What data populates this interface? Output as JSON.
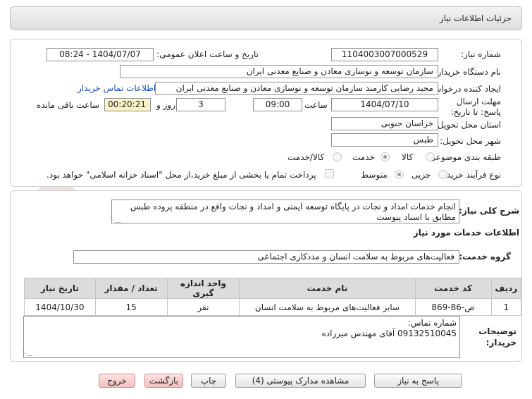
{
  "header": {
    "title": "جزئیات اطلاعات نیاز"
  },
  "form": {
    "need_number_label": "شماره نیاز:",
    "need_number": "1104003007000529",
    "announce_label": "تاریخ و ساعت اعلان عمومی:",
    "announce_value": "1404/07/07 - 08:24",
    "buyer_org_label": "نام دستگاه خریدار:",
    "buyer_org": "سازمان توسعه و نوسازی معادن و صنایع معدنی ایران",
    "creator_label": "ایجاد کننده درخواست:",
    "creator": "مجید رضایی  کارمند  سازمان توسعه و نوسازی معادن و صنایع معدنی ایران",
    "contact_link": "اطلاعات تماس خریدار",
    "deadline_label": "مهلت ارسال پاسخ: تا تاریخ:",
    "deadline_date": "1404/07/10",
    "time_label": "ساعت",
    "deadline_time": "09:00",
    "days_value": "3",
    "days_label": "روز و",
    "remaining_value": "00:20:21",
    "remaining_label": "ساعت باقی مانده",
    "province_label": "استان محل تحویل:",
    "province": "خراسان جنوبی",
    "city_label": "شهر محل تحویل:",
    "city": "طبس",
    "category_label": "طبقه بندی موضوعی:",
    "category_options": [
      "کالا",
      "خدمت",
      "کالا/خدمت"
    ],
    "process_label": "نوع فرآیند خرید :",
    "process_options": [
      "جزیی",
      "متوسط"
    ],
    "payment_note": "پرداخت تمام یا بخشی از مبلغ خرید،از محل \"اسناد خزانه اسلامی\" خواهد بود."
  },
  "description": {
    "label": "شرح کلی نیاز:",
    "text": "انجام خدمات امداد و نجات در پایگاه توسعه ایمنی و امداد و نجات واقع در منطقه پروده طبس مطابق با اسناد پیوست"
  },
  "services": {
    "section_title": "اطلاعات خدمات مورد نیاز",
    "group_label": "گروه خدمت:",
    "group_value": "فعالیت‌های مربوط به سلامت انسان و مددکاری اجتماعی",
    "table": {
      "headers": [
        "ردیف",
        "کد خدمت",
        "نام خدمت",
        "واحد اندازه گیری",
        "تعداد / مقدار",
        "تاریخ نیاز"
      ],
      "rows": [
        [
          "1",
          "ص-86-869",
          "سایر فعالیت‌های مربوط به سلامت انسان",
          "نفر",
          "15",
          "1404/10/30"
        ]
      ]
    }
  },
  "buyer_notes": {
    "label": "توضیحات خریدار:",
    "line1": "شماره تماس:",
    "line2": "09132510045 آقای مهندس میرزاده"
  },
  "buttons": {
    "reply": "پاسخ به نیاز",
    "attachments": "مشاهده مدارک پیوستی (4)",
    "print": "چاپ",
    "back": "بازگشت",
    "exit": "خروج"
  },
  "watermark": {
    "text": "AriaTender.net"
  }
}
